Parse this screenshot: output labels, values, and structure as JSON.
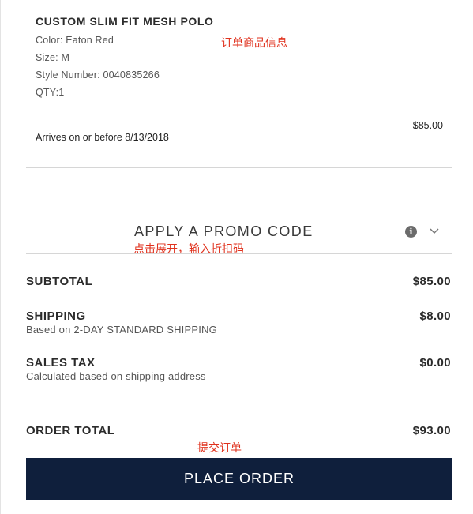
{
  "product": {
    "name": "CUSTOM SLIM FIT MESH POLO",
    "color": "Color: Eaton Red",
    "size": "Size: M",
    "style_number": "Style Number: 0040835266",
    "qty": "QTY:1",
    "arrival": "Arrives on or before 8/13/2018",
    "price": "$85.00"
  },
  "annotations": {
    "order_info": "订单商品信息",
    "promo_hint": "点击展开，输入折扣码",
    "submit_hint": "提交订单"
  },
  "promo": {
    "label": "APPLY A PROMO CODE",
    "info_icon": "i"
  },
  "summary": {
    "subtotal_label": "SUBTOTAL",
    "subtotal_value": "$85.00",
    "shipping_label": "SHIPPING",
    "shipping_sub": "Based on 2-DAY STANDARD SHIPPING",
    "shipping_value": "$8.00",
    "tax_label": "SALES TAX",
    "tax_sub": "Calculated based on shipping address",
    "tax_value": "$0.00",
    "total_label": "ORDER TOTAL",
    "total_value": "$93.00"
  },
  "actions": {
    "place_order": "PLACE ORDER"
  },
  "icons": [
    "info-icon",
    "chevron-down-icon"
  ],
  "colors": {
    "button_bg": "#0f1f3c",
    "annotation": "#e0321e"
  }
}
